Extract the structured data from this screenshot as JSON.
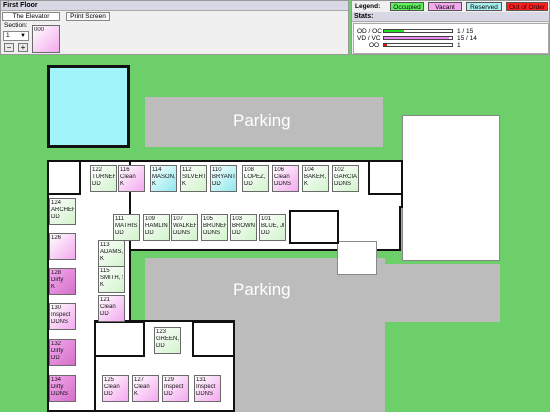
{
  "floor_panel": {
    "title": "First Floor",
    "tab_active": "The Elevator",
    "tab_print": "Print Screen",
    "section_label": "Section:",
    "section_value": "1",
    "minus": "−",
    "plus": "+",
    "mini_room": "000"
  },
  "legend": {
    "title": "Legend:",
    "items": [
      {
        "label": "Occupied",
        "color": "#5ef05e"
      },
      {
        "label": "Vacant",
        "color": "#f4a8ee"
      },
      {
        "label": "Reserved",
        "color": "#a8f0f0"
      },
      {
        "label": "Out of Order",
        "color": "#ff2020"
      }
    ]
  },
  "stats": {
    "title": "Stats:",
    "rows": [
      {
        "label": "OD / OC",
        "value": "1 / 15",
        "bar_color": "#22dd22",
        "fill": 0.3
      },
      {
        "label": "VD / VC",
        "value": "15 / 14",
        "bar_color": "#ee88ee",
        "fill": 0.95
      },
      {
        "label": "OO",
        "value": "1",
        "bar_color": "#dd1111",
        "fill": 0.04
      }
    ]
  },
  "map": {
    "parking_top": "Parking",
    "parking_bottom": "Parking",
    "rooms": [
      {
        "num": "122",
        "l1": "TURNER,",
        "l2": "DD",
        "status": "occ"
      },
      {
        "num": "116",
        "l1": "Clean",
        "l2": "K",
        "status": "vac"
      },
      {
        "num": "114",
        "l1": "MASON, J",
        "l2": "K",
        "status": "res"
      },
      {
        "num": "112",
        "l1": "SILVERTO",
        "l2": "K",
        "status": "occ"
      },
      {
        "num": "110",
        "l1": "BRYANT,",
        "l2": "DD",
        "status": "res"
      },
      {
        "num": "108",
        "l1": "LOPEZ, L",
        "l2": "DD",
        "status": "occ"
      },
      {
        "num": "106",
        "l1": "Clean",
        "l2": "DDNS",
        "status": "vac"
      },
      {
        "num": "104",
        "l1": "BAKER, B",
        "l2": "K",
        "status": "occ"
      },
      {
        "num": "102",
        "l1": "GARCIA,",
        "l2": "DDNS",
        "status": "occ"
      },
      {
        "num": "124",
        "l1": "ARCHER,",
        "l2": "DD",
        "status": "occ"
      },
      {
        "num": "126",
        "l1": "",
        "l2": "",
        "status": "vac"
      },
      {
        "num": "128",
        "l1": "Dirty",
        "l2": "K",
        "status": "vacd"
      },
      {
        "num": "130",
        "l1": "Inspect",
        "l2": "DDNS",
        "status": "vac"
      },
      {
        "num": "132",
        "l1": "Dirty",
        "l2": "DD",
        "status": "vacd"
      },
      {
        "num": "134",
        "l1": "Dirty",
        "l2": "DDNS",
        "status": "vacd"
      },
      {
        "num": "111",
        "l1": "MATHIS,",
        "l2": "DD",
        "status": "occ"
      },
      {
        "num": "109",
        "l1": "HAMLIN,",
        "l2": "DD",
        "status": "occ"
      },
      {
        "num": "107",
        "l1": "WALKER,",
        "l2": "DDNS",
        "status": "occ"
      },
      {
        "num": "105",
        "l1": "BRUNER,",
        "l2": "DDNS",
        "status": "occ"
      },
      {
        "num": "103",
        "l1": "BROWN,",
        "l2": "DD",
        "status": "occ"
      },
      {
        "num": "101",
        "l1": "BLUE, JE",
        "l2": "DD",
        "status": "occ"
      },
      {
        "num": "113",
        "l1": "ADAMS, Z",
        "l2": "K",
        "status": "occ"
      },
      {
        "num": "115",
        "l1": "SMITH, S",
        "l2": "K",
        "status": "occ"
      },
      {
        "num": "121",
        "l1": "Clean",
        "l2": "DD",
        "status": "vac"
      },
      {
        "num": "123",
        "l1": "GREEN, C",
        "l2": "DD",
        "status": "occ"
      },
      {
        "num": "125",
        "l1": "Clean",
        "l2": "DD",
        "status": "vac"
      },
      {
        "num": "127",
        "l1": "Clean",
        "l2": "K",
        "status": "vac"
      },
      {
        "num": "129",
        "l1": "Inspect",
        "l2": "DD",
        "status": "vac"
      },
      {
        "num": "131",
        "l1": "Inspect",
        "l2": "DDNS",
        "status": "vac"
      }
    ]
  }
}
